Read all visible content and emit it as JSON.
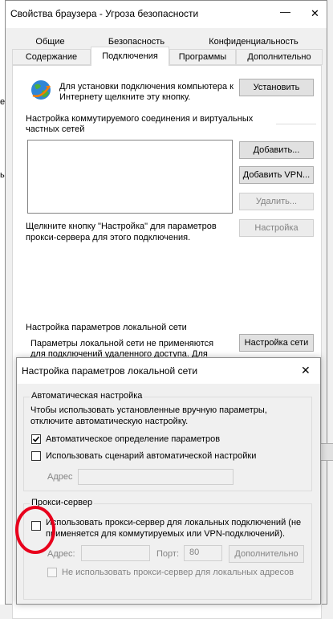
{
  "main_window": {
    "title": "Свойства браузера - Угроза безопасности",
    "minimize_glyph": "—",
    "close_glyph": "✕",
    "tabs_row1": [
      "Общие",
      "Безопасность",
      "Конфиденциальность"
    ],
    "tabs_row2": [
      "Содержание",
      "Подключения",
      "Программы",
      "Дополнительно"
    ],
    "active_tab": "Подключения",
    "setup_text": "Для установки подключения компьютера к Интернету щелкните эту кнопку.",
    "setup_button": "Установить",
    "dialup_header": "Настройка коммутируемого соединения и виртуальных частных сетей",
    "add_button": "Добавить...",
    "add_vpn_button": "Добавить VPN...",
    "remove_button": "Удалить...",
    "settings_button": "Настройка",
    "proxy_hint": "Щелкните кнопку \"Настройка\" для параметров прокси-сервера для этого подключения.",
    "lan_header": "Настройка параметров локальной сети",
    "lan_text": "Параметры локальной сети не применяются для подключений удаленного доступа. Для",
    "lan_button": "Настройка сети"
  },
  "lan_dialog": {
    "title": "Настройка параметров локальной сети",
    "close_glyph": "✕",
    "auto_group_title": "Автоматическая настройка",
    "auto_desc": "Чтобы использовать установленные вручную параметры, отключите автоматическую настройку.",
    "auto_detect_label": "Автоматическое определение параметров",
    "auto_detect_checked": true,
    "use_script_label": "Использовать сценарий автоматической настройки",
    "use_script_checked": false,
    "script_address_label": "Адрес",
    "proxy_group_title": "Прокси-сервер",
    "use_proxy_label": "Использовать прокси-сервер для локальных подключений (не применяется для коммутируемых или VPN-подключений).",
    "use_proxy_checked": false,
    "proxy_address_label": "Адрес:",
    "proxy_port_label": "Порт:",
    "proxy_port_value": "80",
    "advanced_button": "Дополнительно",
    "bypass_label": "Не использовать прокси-сервер для локальных адресов",
    "bypass_checked": false
  },
  "annotation": {
    "color": "#e8001c",
    "shape": "ellipse"
  },
  "behind_panel_fragments": [
    "е",
    "ь"
  ]
}
